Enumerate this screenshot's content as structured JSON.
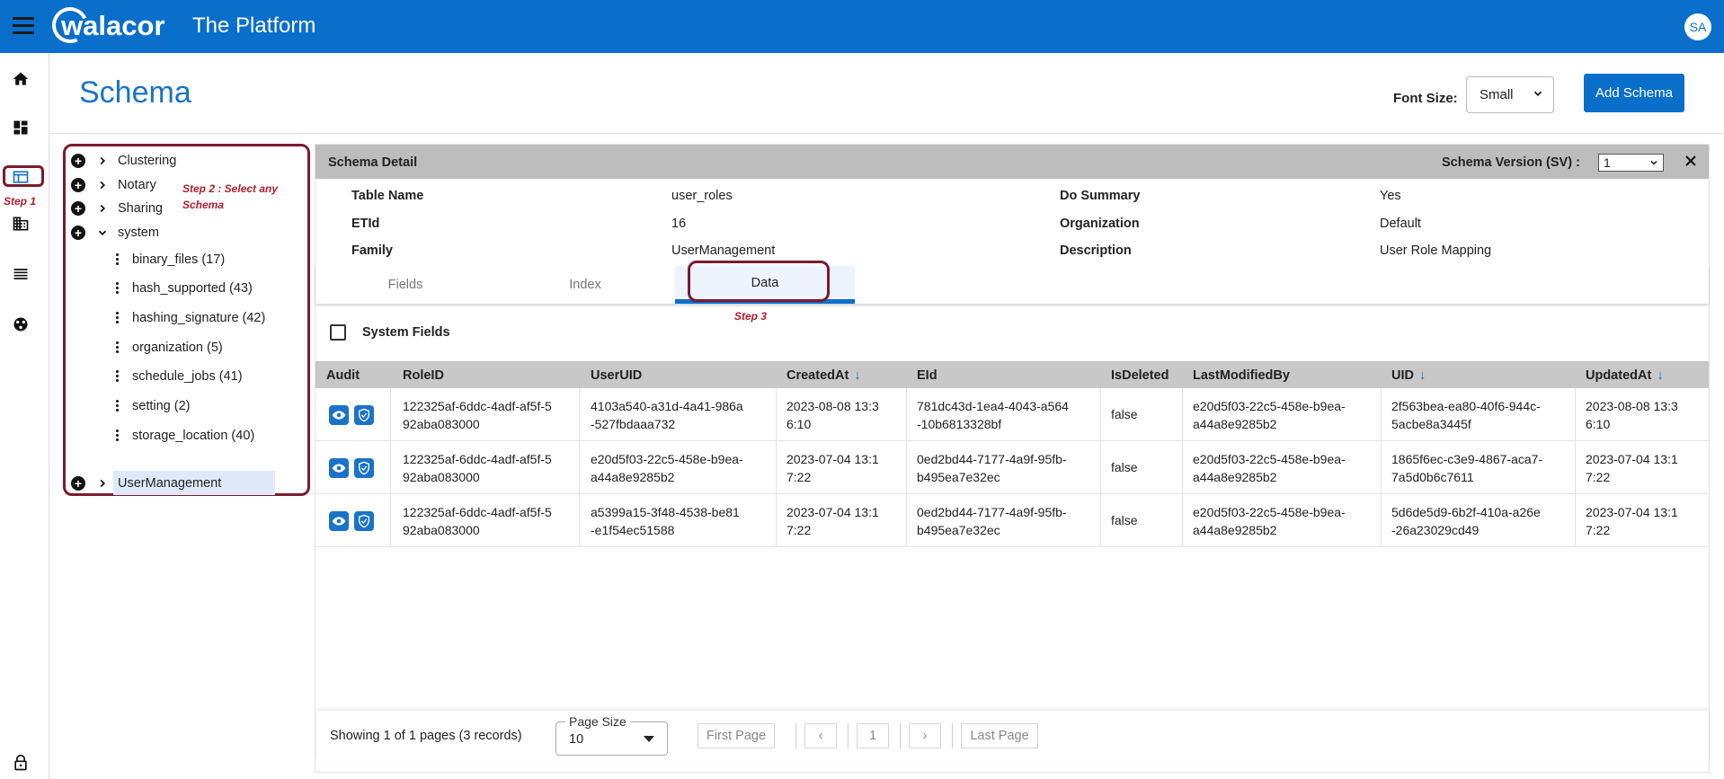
{
  "header": {
    "brand": "walacor",
    "title": "The Platform",
    "user_initials": "SA"
  },
  "rail": {
    "items": [
      "home-icon",
      "dashboard-icon",
      "schema-icon",
      "organization-icon",
      "list-icon",
      "network-icon",
      "lock-icon"
    ],
    "step1": "Step 1"
  },
  "page": {
    "title": "Schema",
    "font_size_label": "Font Size:",
    "font_size_value": "Small",
    "add_schema": "Add Schema"
  },
  "tree": {
    "step2": "Step 2 : Select any Schema",
    "top": [
      "Clustering",
      "Notary",
      "Sharing",
      "system"
    ],
    "system_children": [
      "binary_files (17)",
      "hash_supported (43)",
      "hashing_signature (42)",
      "organization (5)",
      "schedule_jobs (41)",
      "setting (2)",
      "storage_location (40)"
    ],
    "selected": "UserManagement"
  },
  "detail": {
    "title": "Schema Detail",
    "sv_label": "Schema Version (SV) :",
    "sv_value": "1",
    "meta": {
      "table_name_k": "Table Name",
      "table_name_v": "user_roles",
      "etid_k": "ETId",
      "etid_v": "16",
      "family_k": "Family",
      "family_v": "UserManagement",
      "do_summary_k": "Do Summary",
      "do_summary_v": "Yes",
      "organization_k": "Organization",
      "organization_v": "Default",
      "description_k": "Description",
      "description_v": "User Role Mapping"
    },
    "tabs": [
      "Fields",
      "Index",
      "Data"
    ],
    "step3": "Step 3",
    "system_fields": "System Fields"
  },
  "table": {
    "columns": [
      "Audit",
      "RoleID",
      "UserUID",
      "CreatedAt",
      "EId",
      "IsDeleted",
      "LastModifiedBy",
      "UID",
      "UpdatedAt"
    ],
    "rows": [
      {
        "roleid": "122325af-6ddc-4adf-af5f-592aba083000",
        "useruid": "4103a540-a31d-4a41-986a-527fbdaaa732",
        "createdat": "2023-08-08 13:36:10",
        "eid": "781dc43d-1ea4-4043-a564-10b6813328bf",
        "isdeleted": "false",
        "lastmodifiedby": "e20d5f03-22c5-458e-b9ea-a44a8e9285b2",
        "uid": "2f563bea-ea80-40f6-944c-5acbe8a3445f",
        "updatedat": "2023-08-08 13:36:10"
      },
      {
        "roleid": "122325af-6ddc-4adf-af5f-592aba083000",
        "useruid": "e20d5f03-22c5-458e-b9ea-a44a8e9285b2",
        "createdat": "2023-07-04 13:17:22",
        "eid": "0ed2bd44-7177-4a9f-95fb-b495ea7e32ec",
        "isdeleted": "false",
        "lastmodifiedby": "e20d5f03-22c5-458e-b9ea-a44a8e9285b2",
        "uid": "1865f6ec-c3e9-4867-aca7-7a5d0b6c7611",
        "updatedat": "2023-07-04 13:17:22"
      },
      {
        "roleid": "122325af-6ddc-4adf-af5f-592aba083000",
        "useruid": "a5399a15-3f48-4538-be81-e1f54ec51588",
        "createdat": "2023-07-04 13:17:22",
        "eid": "0ed2bd44-7177-4a9f-95fb-b495ea7e32ec",
        "isdeleted": "false",
        "lastmodifiedby": "e20d5f03-22c5-458e-b9ea-a44a8e9285b2",
        "uid": "5d6de5d9-6b2f-410a-a26e-26a23029cd49",
        "updatedat": "2023-07-04 13:17:22"
      }
    ]
  },
  "pagination": {
    "showing": "Showing 1 of 1 pages (3 records)",
    "page_size_label": "Page Size",
    "page_size_value": "10",
    "first": "First Page",
    "prev": "‹",
    "current": "1",
    "next": "›",
    "last": "Last Page"
  },
  "colors": {
    "brand": "#0a6fcb",
    "annotation": "#7a1b30",
    "annotation_text": "#b01c2e"
  }
}
